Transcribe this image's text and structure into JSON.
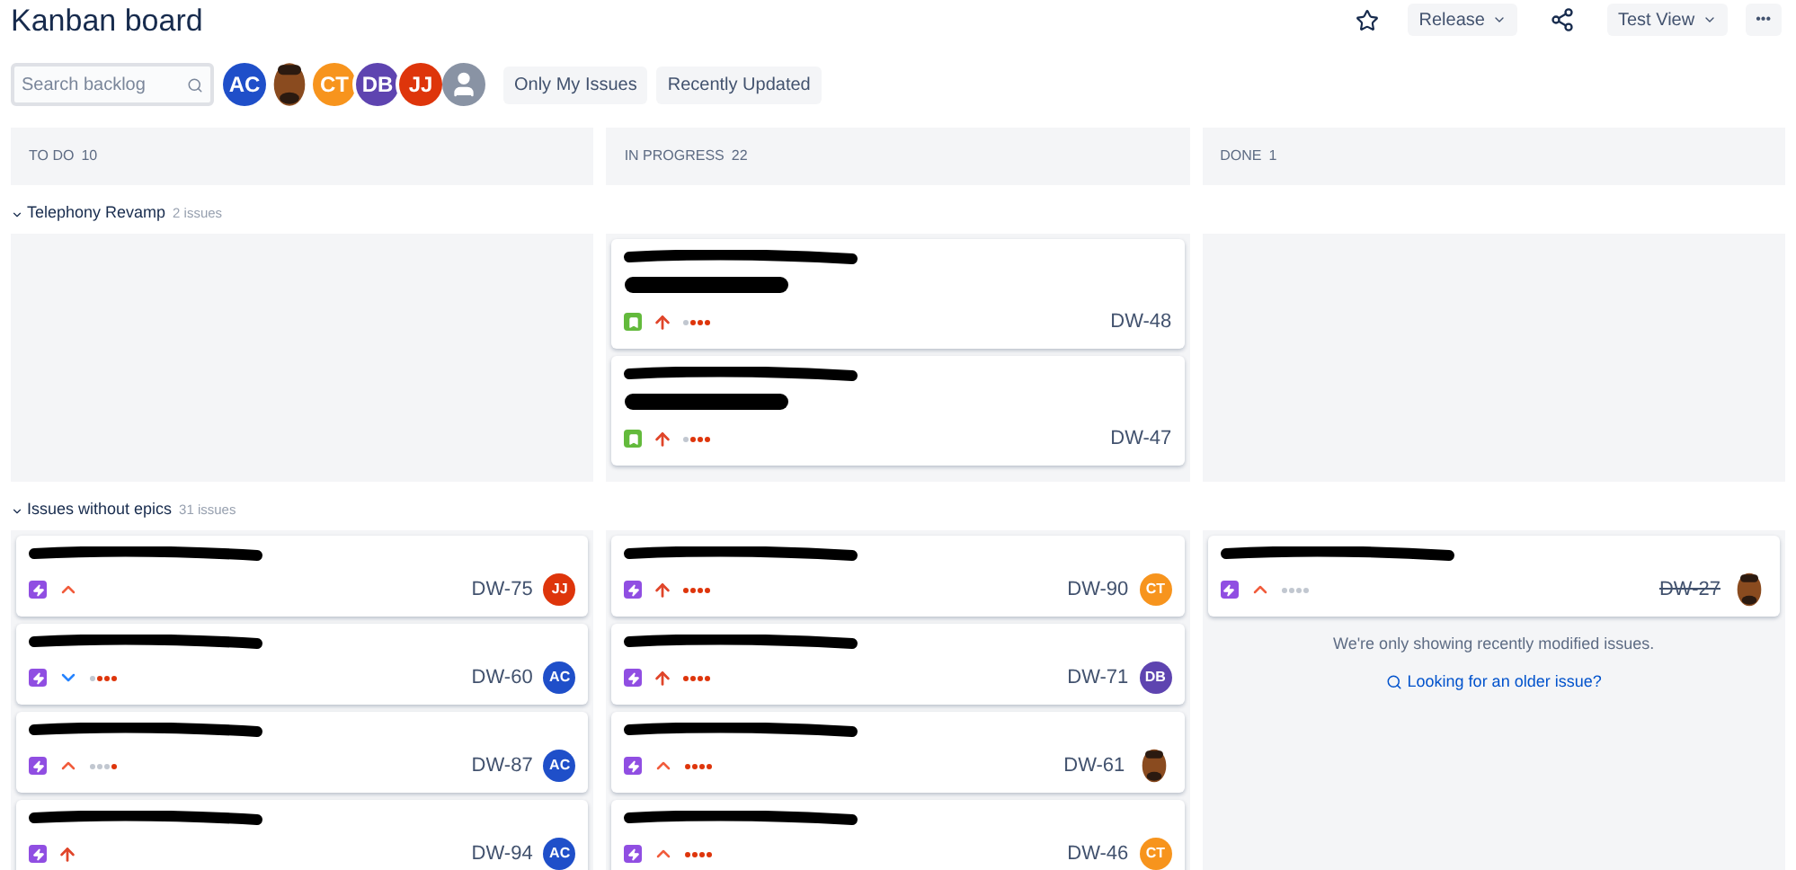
{
  "title": "Kanban board",
  "header_actions": [
    {
      "kind": "star"
    },
    {
      "kind": "dropdown",
      "label": "Release"
    },
    {
      "kind": "share"
    },
    {
      "kind": "dropdown",
      "label": "Test View"
    },
    {
      "kind": "more",
      "label": "•••"
    }
  ],
  "search": {
    "placeholder": "Search backlog"
  },
  "avatars": [
    {
      "kind": "initials",
      "label": "AC",
      "color": "#1f4fc9"
    },
    {
      "kind": "photo"
    },
    {
      "kind": "initials",
      "label": "CT",
      "color": "#f7941d"
    },
    {
      "kind": "initials",
      "label": "DB",
      "color": "#5e44b0"
    },
    {
      "kind": "initials",
      "label": "JJ",
      "color": "#de350b"
    },
    {
      "kind": "generic"
    }
  ],
  "quick_filters": [
    {
      "label": "Only My Issues",
      "selected": false
    },
    {
      "label": "Recently Updated",
      "selected": false
    }
  ],
  "columns": [
    {
      "name": "TO DO",
      "count": "10"
    },
    {
      "name": "IN PROGRESS",
      "count": "22"
    },
    {
      "name": "DONE",
      "count": "1"
    }
  ],
  "swimlanes": [
    {
      "name": "Telephony Revamp",
      "count": "2 issues",
      "expanded": true,
      "cells": [
        [],
        [
          {
            "key": "DW-48",
            "type": {
              "kind": "story"
            },
            "priority": {
              "kind": "highest"
            },
            "stars": 3,
            "done": false,
            "epic_label": true
          },
          {
            "key": "DW-47",
            "type": {
              "kind": "story"
            },
            "priority": {
              "kind": "highest"
            },
            "stars": 3,
            "done": false,
            "epic_label": true
          }
        ],
        []
      ]
    },
    {
      "name": "Issues without epics",
      "count": "31 issues",
      "expanded": true,
      "cells": [
        [
          {
            "key": "DW-75",
            "type": {
              "kind": "epic"
            },
            "priority": {
              "kind": "high"
            },
            "done": false,
            "assignee": {
              "kind": "initials",
              "label": "JJ",
              "color": "#de350b"
            }
          },
          {
            "key": "DW-60",
            "type": {
              "kind": "epic"
            },
            "priority": {
              "kind": "low"
            },
            "stars": 3,
            "done": false,
            "assignee": {
              "kind": "initials",
              "label": "AC",
              "color": "#1f4fc9"
            }
          },
          {
            "key": "DW-87",
            "type": {
              "kind": "epic"
            },
            "priority": {
              "kind": "high"
            },
            "stars": 1,
            "done": false,
            "assignee": {
              "kind": "initials",
              "label": "AC",
              "color": "#1f4fc9"
            }
          },
          {
            "key": "DW-94",
            "type": {
              "kind": "epic"
            },
            "priority": {
              "kind": "highest"
            },
            "done": false,
            "assignee": {
              "kind": "initials",
              "label": "AC",
              "color": "#1f4fc9"
            }
          }
        ],
        [
          {
            "key": "DW-90",
            "type": {
              "kind": "epic"
            },
            "priority": {
              "kind": "highest"
            },
            "stars": 4,
            "done": false,
            "assignee": {
              "kind": "initials",
              "label": "CT",
              "color": "#f7941d"
            }
          },
          {
            "key": "DW-71",
            "type": {
              "kind": "epic"
            },
            "priority": {
              "kind": "highest"
            },
            "stars": 4,
            "done": false,
            "assignee": {
              "kind": "initials",
              "label": "DB",
              "color": "#5e44b0"
            }
          },
          {
            "key": "DW-61",
            "type": {
              "kind": "epic"
            },
            "priority": {
              "kind": "high"
            },
            "stars": 4,
            "done": false,
            "assignee": {
              "kind": "photo"
            }
          },
          {
            "key": "DW-46",
            "type": {
              "kind": "epic"
            },
            "priority": {
              "kind": "high"
            },
            "stars": 4,
            "done": false,
            "assignee": {
              "kind": "initials",
              "label": "CT",
              "color": "#f7941d"
            }
          }
        ],
        [
          {
            "key": "DW-27",
            "type": {
              "kind": "epic"
            },
            "priority": {
              "kind": "high"
            },
            "stars": 0,
            "done": true,
            "assignee": {
              "kind": "photo"
            }
          }
        ]
      ],
      "done_note": {
        "message": "We're only showing recently modified issues.",
        "link": "Looking for an older issue?"
      }
    }
  ]
}
